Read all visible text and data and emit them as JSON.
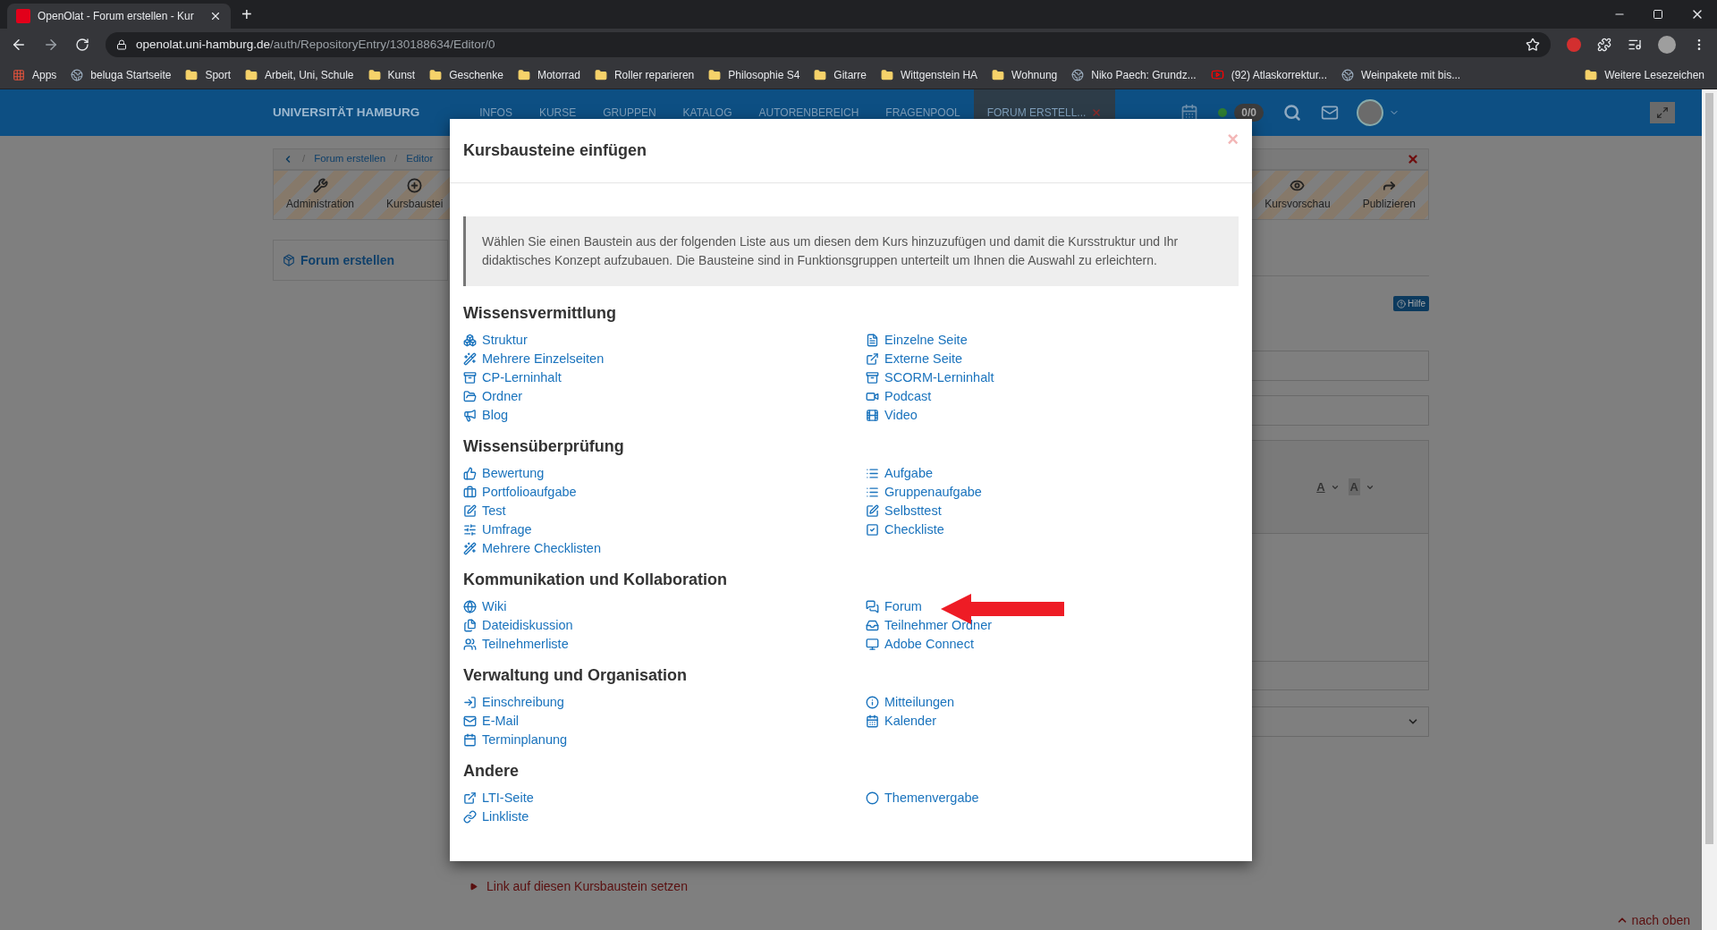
{
  "browser": {
    "tab": {
      "title": "OpenOlat - Forum erstellen - Kur"
    },
    "new_tab": "+",
    "address": {
      "host": "openolat.uni-hamburg.de",
      "path": "/auth/RepositoryEntry/130188634/Editor/0"
    },
    "bookmarks": [
      {
        "label": "Apps",
        "kind": "apps"
      },
      {
        "label": "beluga Startseite",
        "kind": "site"
      },
      {
        "label": "Sport",
        "kind": "folder"
      },
      {
        "label": "Arbeit, Uni, Schule",
        "kind": "folder"
      },
      {
        "label": "Kunst",
        "kind": "folder"
      },
      {
        "label": "Geschenke",
        "kind": "folder"
      },
      {
        "label": "Motorrad",
        "kind": "folder"
      },
      {
        "label": "Roller reparieren",
        "kind": "folder"
      },
      {
        "label": "Philosophie S4",
        "kind": "folder"
      },
      {
        "label": "Gitarre",
        "kind": "folder"
      },
      {
        "label": "Wittgenstein HA",
        "kind": "folder"
      },
      {
        "label": "Wohnung",
        "kind": "folder"
      },
      {
        "label": "Niko Paech: Grundz...",
        "kind": "site"
      },
      {
        "label": "(92) Atlaskorrektur...",
        "kind": "video"
      },
      {
        "label": "Weinpakete mit bis...",
        "kind": "site"
      }
    ],
    "other_bookmarks": "Weitere Lesezeichen"
  },
  "app": {
    "brand": "UNIVERSITÄT HAMBURG",
    "nav": [
      {
        "label": "INFOS",
        "selected": false
      },
      {
        "label": "KURSE",
        "selected": false
      },
      {
        "label": "GRUPPEN",
        "selected": false
      },
      {
        "label": "KATALOG",
        "selected": false
      },
      {
        "label": "AUTORENBEREICH",
        "selected": false
      },
      {
        "label": "FRAGENPOOL",
        "selected": false
      },
      {
        "label": "FORUM ERSTELL...",
        "selected": true
      }
    ],
    "counter": "0/0"
  },
  "page": {
    "breadcrumb_separator": "/",
    "breadcrumbs": [
      "Forum erstellen",
      "Editor"
    ],
    "toolbar": [
      "Administration",
      "Kursbaustei",
      "Kursvorschau",
      "Publizieren"
    ],
    "course_title": "Forum erstellen",
    "help": "Hilfe",
    "editor_buttons": [
      "A",
      "A"
    ],
    "link_action": "Link auf diesen Kursbaustein setzen",
    "back_to_top": "nach oben"
  },
  "dialog": {
    "title": "Kursbausteine einfügen",
    "close": "×",
    "intro": "Wählen Sie einen Baustein aus der folgenden Liste aus um diesen dem Kurs hinzuzufügen und damit die Kursstruktur und Ihr didaktisches Konzept aufzubauen. Die Bausteine sind in Funktionsgruppen unterteilt um Ihnen die Auswahl zu erleichtern.",
    "sections": [
      {
        "heading": "Wissensvermittlung",
        "left": [
          "Struktur",
          "Mehrere Einzelseiten",
          "CP-Lerninhalt",
          "Ordner",
          "Blog"
        ],
        "right": [
          "Einzelne Seite",
          "Externe Seite",
          "SCORM-Lerninhalt",
          "Podcast",
          "Video"
        ]
      },
      {
        "heading": "Wissensüberprüfung",
        "left": [
          "Bewertung",
          "Portfolioaufgabe",
          "Test",
          "Umfrage",
          "Mehrere Checklisten"
        ],
        "right": [
          "Aufgabe",
          "Gruppenaufgabe",
          "Selbsttest",
          "Checkliste"
        ]
      },
      {
        "heading": "Kommunikation und Kollaboration",
        "left": [
          "Wiki",
          "Dateidiskussion",
          "Teilnehmerliste"
        ],
        "right": [
          "Forum",
          "Teilnehmer Ordner",
          "Adobe Connect"
        ]
      },
      {
        "heading": "Verwaltung und Organisation",
        "left": [
          "Einschreibung",
          "E-Mail",
          "Terminplanung"
        ],
        "right": [
          "Mitteilungen",
          "Kalender"
        ]
      },
      {
        "heading": "Andere",
        "left": [
          "LTI-Seite",
          "Linkliste"
        ],
        "right": [
          "Themenvergabe"
        ]
      }
    ]
  }
}
